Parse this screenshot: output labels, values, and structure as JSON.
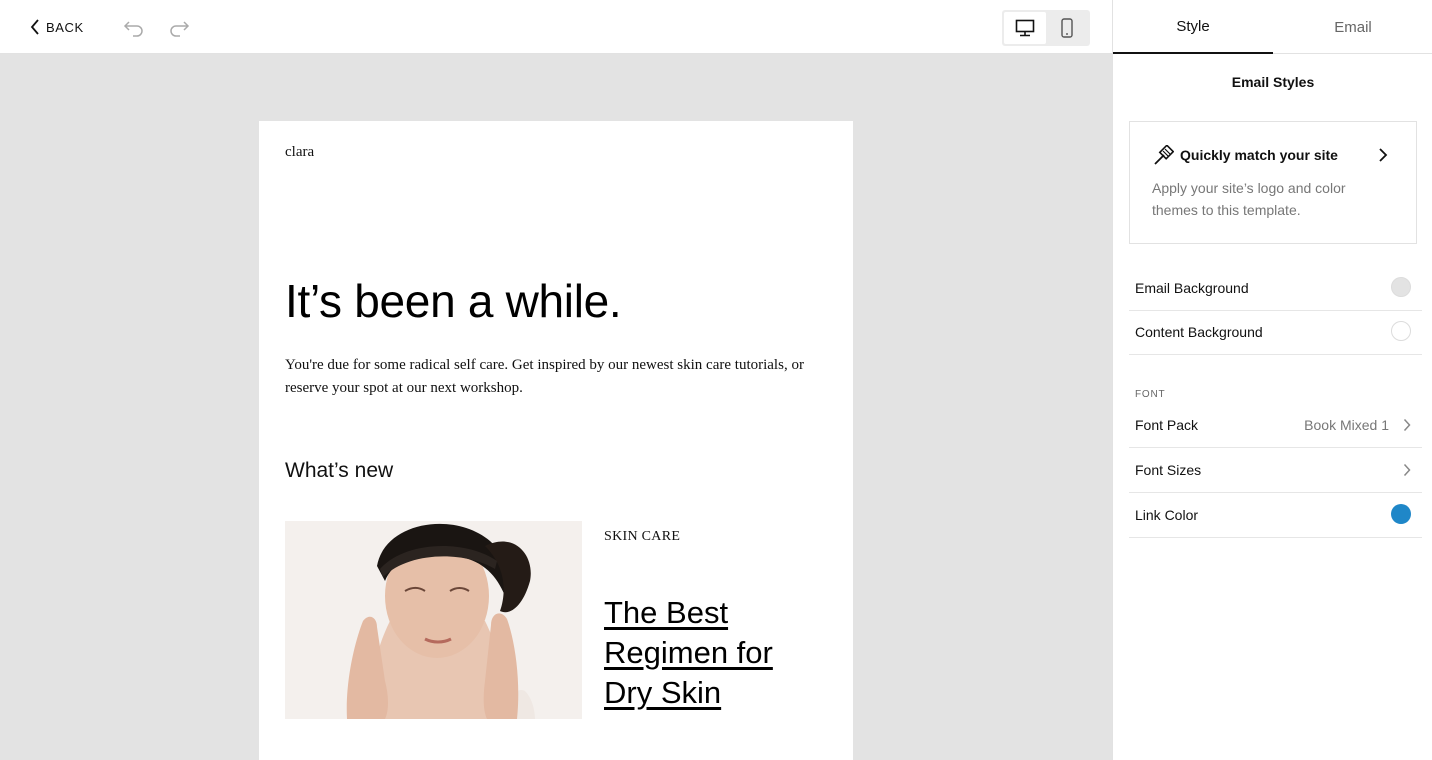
{
  "toolbar": {
    "back_label": "BACK",
    "undo_icon": "undo-icon",
    "redo_icon": "redo-icon",
    "view_modes": [
      "desktop",
      "mobile"
    ],
    "active_view": "desktop"
  },
  "email": {
    "brand": "clara",
    "headline": "It’s been a while.",
    "intro": "You're due for some radical self care. Get inspired by our newest skin care tutorials, or reserve your spot at our next workshop.",
    "section_title": "What’s new",
    "article": {
      "category": "SKIN CARE",
      "title": "The Best Regimen for Dry Skin"
    }
  },
  "panel": {
    "tabs": [
      {
        "label": "Style",
        "active": true
      },
      {
        "label": "Email",
        "active": false
      }
    ],
    "title": "Email Styles",
    "match_card": {
      "title": "Quickly match your site",
      "description": "Apply your site’s logo and color themes to this template."
    },
    "rows": {
      "email_background": {
        "label": "Email Background",
        "color": "#e3e3e3"
      },
      "content_background": {
        "label": "Content Background",
        "color": "#ffffff"
      }
    },
    "font_section_label": "FONT",
    "font_pack": {
      "label": "Font Pack",
      "value": "Book Mixed 1"
    },
    "font_sizes": {
      "label": "Font Sizes"
    },
    "link_color": {
      "label": "Link Color",
      "color": "#1f87c8"
    }
  }
}
